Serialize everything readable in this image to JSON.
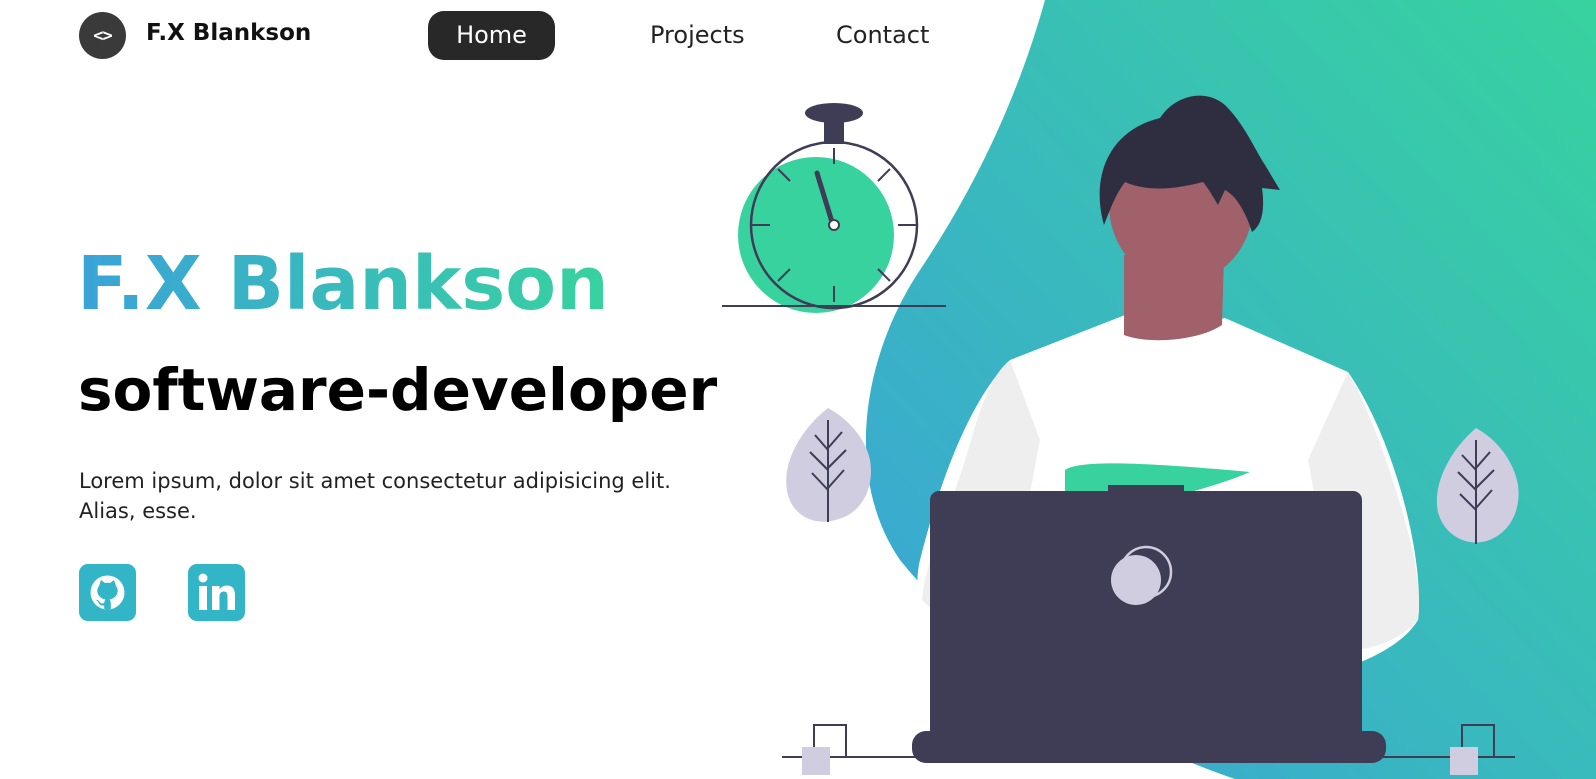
{
  "colors": {
    "gradient_start": "#3aa3d8",
    "gradient_end": "#38d29f",
    "nav_active_bg": "#282828",
    "social_bg": "#31b5c7",
    "laptop": "#3f3d56"
  },
  "nav": {
    "logo_symbol": "<>",
    "brand": "F.X Blankson",
    "links": [
      {
        "label": "Home",
        "active": true
      },
      {
        "label": "Projects",
        "active": false
      },
      {
        "label": "Contact",
        "active": false
      }
    ]
  },
  "hero": {
    "name": "F.X Blankson",
    "role": "software-developer",
    "description": "Lorem ipsum, dolor sit amet consectetur adipisicing elit. Alias, esse."
  },
  "social": [
    {
      "icon": "github-icon"
    },
    {
      "icon": "linkedin-icon"
    }
  ],
  "illustration": {
    "subject": "developer-at-laptop-illustration",
    "icons": [
      "stopwatch-icon",
      "leaf-icon",
      "laptop-icon"
    ]
  }
}
